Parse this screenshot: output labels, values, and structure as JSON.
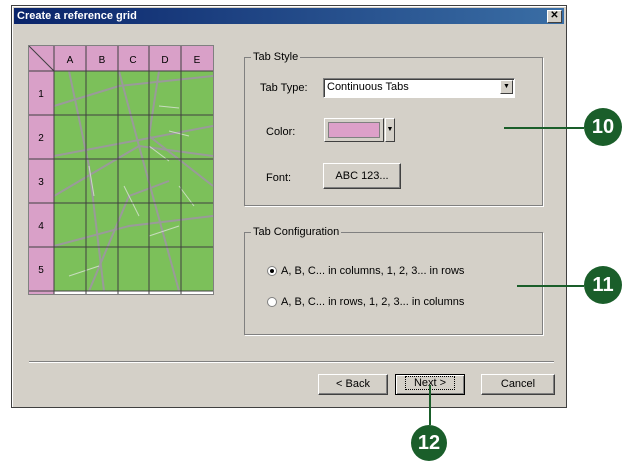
{
  "dialog": {
    "title": "Create a reference grid",
    "close_glyph": "✕"
  },
  "preview": {
    "columns": [
      "A",
      "B",
      "C",
      "D",
      "E"
    ],
    "rows": [
      "1",
      "2",
      "3",
      "4",
      "5"
    ],
    "tab_color": "#d9a0c8",
    "map_color": "#7cc05a"
  },
  "tab_style": {
    "title": "Tab Style",
    "tab_type_label": "Tab Type:",
    "tab_type_value": "Continuous Tabs",
    "color_label": "Color:",
    "color_value": "#dda0c9",
    "font_label": "Font:",
    "font_button": "ABC 123..."
  },
  "tab_config": {
    "title": "Tab Configuration",
    "option1": "A, B, C... in columns, 1, 2, 3... in rows",
    "option2": "A, B, C... in rows, 1, 2, 3... in columns",
    "selected": 1
  },
  "buttons": {
    "back": "< Back",
    "next": "Next >",
    "cancel": "Cancel"
  },
  "callouts": {
    "c10": "10",
    "c11": "11",
    "c12": "12"
  }
}
